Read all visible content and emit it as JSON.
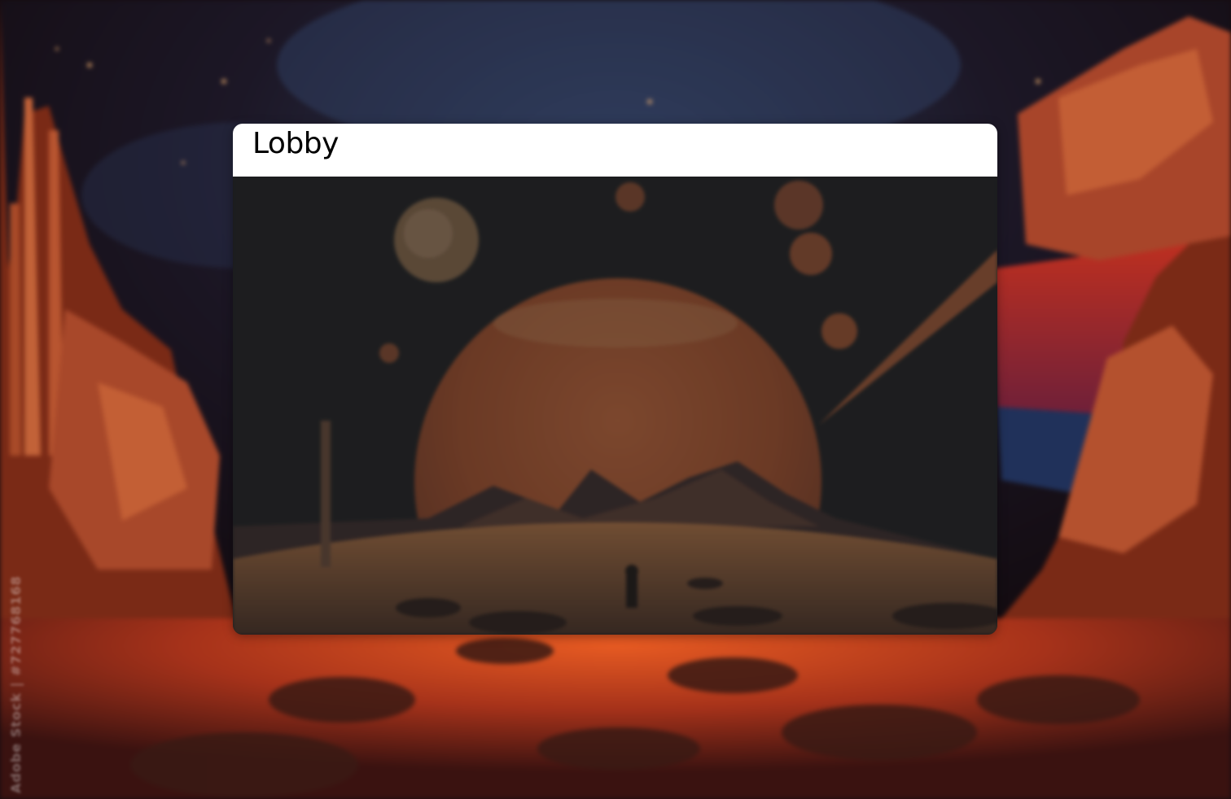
{
  "background": {
    "scene": "pixel-art alien landscape",
    "watermark_text": "Adobe Stock | #727768168",
    "colors": {
      "sky": "#1b1420",
      "rock": "#b2502a",
      "ground": "#c8461c",
      "glow": "#e2732e"
    }
  },
  "lobby": {
    "title": "Lobby",
    "colors": {
      "header_bg": "#ffffff",
      "body_overlay": "#1e1e20",
      "planet": "#b4582c"
    }
  }
}
